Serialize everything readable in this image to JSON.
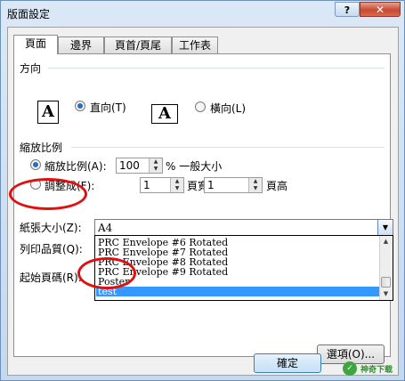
{
  "window": {
    "title": "版面設定",
    "help_label": "?",
    "close_label": "✕"
  },
  "tabs": [
    {
      "label": "頁面",
      "active": true
    },
    {
      "label": "邊界",
      "active": false
    },
    {
      "label": "頁首/頁尾",
      "active": false
    },
    {
      "label": "工作表",
      "active": false
    }
  ],
  "orientation": {
    "section_label": "方向",
    "page_letter": "A",
    "portrait_label": "直向(T)",
    "landscape_label": "橫向(L)",
    "selected": "portrait"
  },
  "scaling": {
    "section_label": "縮放比例",
    "adjust_label": "縮放比例(A):",
    "adjust_value": "100",
    "adjust_suffix": "% 一般大小",
    "fit_label": "調整成(F):",
    "fit_wide_value": "1",
    "fit_wide_suffix": "頁寬",
    "fit_tall_value": "1",
    "fit_tall_suffix": "頁高",
    "selected": "adjust"
  },
  "paper_size": {
    "label": "紙張大小(Z):",
    "value": "A4",
    "options": [
      "PRC Envelope #6 Rotated",
      "PRC Envelope #7 Rotated",
      "PRC Envelope #8 Rotated",
      "PRC Envelope #9 Rotated",
      "Poster",
      "test"
    ],
    "selected_option": "test"
  },
  "print_quality": {
    "label": "列印品質(Q):"
  },
  "first_page_number": {
    "label": "起始頁碼(R):"
  },
  "buttons": {
    "options_label": "選項(O)...",
    "ok_label": "確定"
  },
  "watermark": {
    "logo": "✓",
    "text": "神奇下载"
  },
  "colors": {
    "highlight": "#3399ff",
    "annotation": "#e01010"
  }
}
